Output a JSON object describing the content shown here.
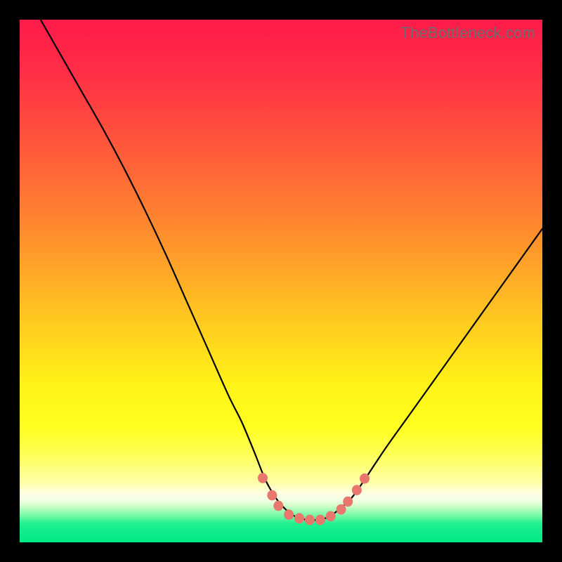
{
  "watermark": "TheBottleneck.com",
  "colors": {
    "black": "#000000",
    "curve": "#000000",
    "marker_fill": "#e8776d",
    "marker_stroke": "#d45b52",
    "watermark": "#6c6c6c",
    "gradient_stops": [
      {
        "offset": 0.0,
        "color": "#ff1b4a"
      },
      {
        "offset": 0.1,
        "color": "#ff2e46"
      },
      {
        "offset": 0.2,
        "color": "#ff4b3f"
      },
      {
        "offset": 0.3,
        "color": "#ff6a36"
      },
      {
        "offset": 0.4,
        "color": "#ff8a2e"
      },
      {
        "offset": 0.5,
        "color": "#ffae26"
      },
      {
        "offset": 0.6,
        "color": "#ffd21e"
      },
      {
        "offset": 0.7,
        "color": "#fff317"
      },
      {
        "offset": 0.78,
        "color": "#ffff20"
      },
      {
        "offset": 0.83,
        "color": "#ffff55"
      },
      {
        "offset": 0.885,
        "color": "#ffffa8"
      },
      {
        "offset": 0.905,
        "color": "#ffffe0"
      },
      {
        "offset": 0.918,
        "color": "#f4ffe6"
      },
      {
        "offset": 0.928,
        "color": "#d8ffce"
      },
      {
        "offset": 0.948,
        "color": "#79f9a6"
      },
      {
        "offset": 0.965,
        "color": "#1ef08f"
      },
      {
        "offset": 1.0,
        "color": "#00e985"
      }
    ]
  },
  "chart_data": {
    "type": "line",
    "title": "",
    "xlabel": "",
    "ylabel": "",
    "xlim": [
      0,
      100
    ],
    "ylim": [
      0,
      100
    ],
    "grid": false,
    "legend": false,
    "series": [
      {
        "name": "bottleneck-curve",
        "x": [
          4,
          8,
          12,
          16,
          20,
          24,
          28,
          32,
          36,
          40,
          42.5,
          45,
          47,
          49,
          51,
          53,
          55,
          57,
          59,
          61,
          63.5,
          66,
          70,
          75,
          80,
          85,
          90,
          95,
          100
        ],
        "y": [
          100,
          93,
          86,
          79,
          71.5,
          63.5,
          55,
          46,
          37,
          28,
          23,
          17,
          12,
          8.5,
          6.2,
          4.8,
          4.3,
          4.3,
          4.8,
          6.2,
          8.5,
          12,
          18,
          25,
          32,
          39,
          46,
          53,
          60
        ]
      }
    ],
    "markers": [
      {
        "x": 46.5,
        "y": 12.3
      },
      {
        "x": 48.3,
        "y": 9.0
      },
      {
        "x": 49.5,
        "y": 7.0
      },
      {
        "x": 51.5,
        "y": 5.3
      },
      {
        "x": 53.5,
        "y": 4.6
      },
      {
        "x": 55.5,
        "y": 4.3
      },
      {
        "x": 57.5,
        "y": 4.3
      },
      {
        "x": 59.5,
        "y": 5.0
      },
      {
        "x": 61.5,
        "y": 6.3
      },
      {
        "x": 62.8,
        "y": 7.8
      },
      {
        "x": 64.5,
        "y": 10.0
      },
      {
        "x": 66.0,
        "y": 12.2
      }
    ],
    "marker_radius_px": 7
  }
}
